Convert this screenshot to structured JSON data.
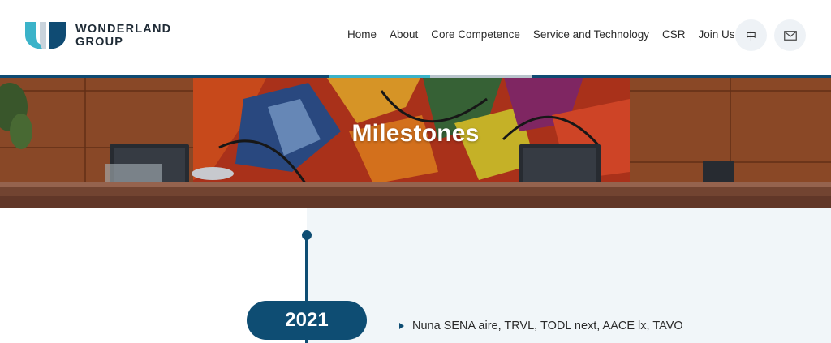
{
  "header": {
    "logo_line1": "WONDERLAND",
    "logo_line2": "GROUP",
    "nav": [
      "Home",
      "About",
      "Core Competence",
      "Service and Technology",
      "CSR",
      "Join Us"
    ],
    "lang_label": "中",
    "mail_icon": "mail-icon"
  },
  "banner": {
    "title": "Milestones"
  },
  "timeline": {
    "year": "2021",
    "items": [
      "Nuna SENA aire, TRVL, TODL next, AACE lx, TAVO"
    ]
  },
  "colors": {
    "primary": "#0e4d73",
    "panel_bg": "#f1f6f9",
    "logo_teal": "#3bb3c9",
    "logo_navy": "#0f4b73"
  }
}
